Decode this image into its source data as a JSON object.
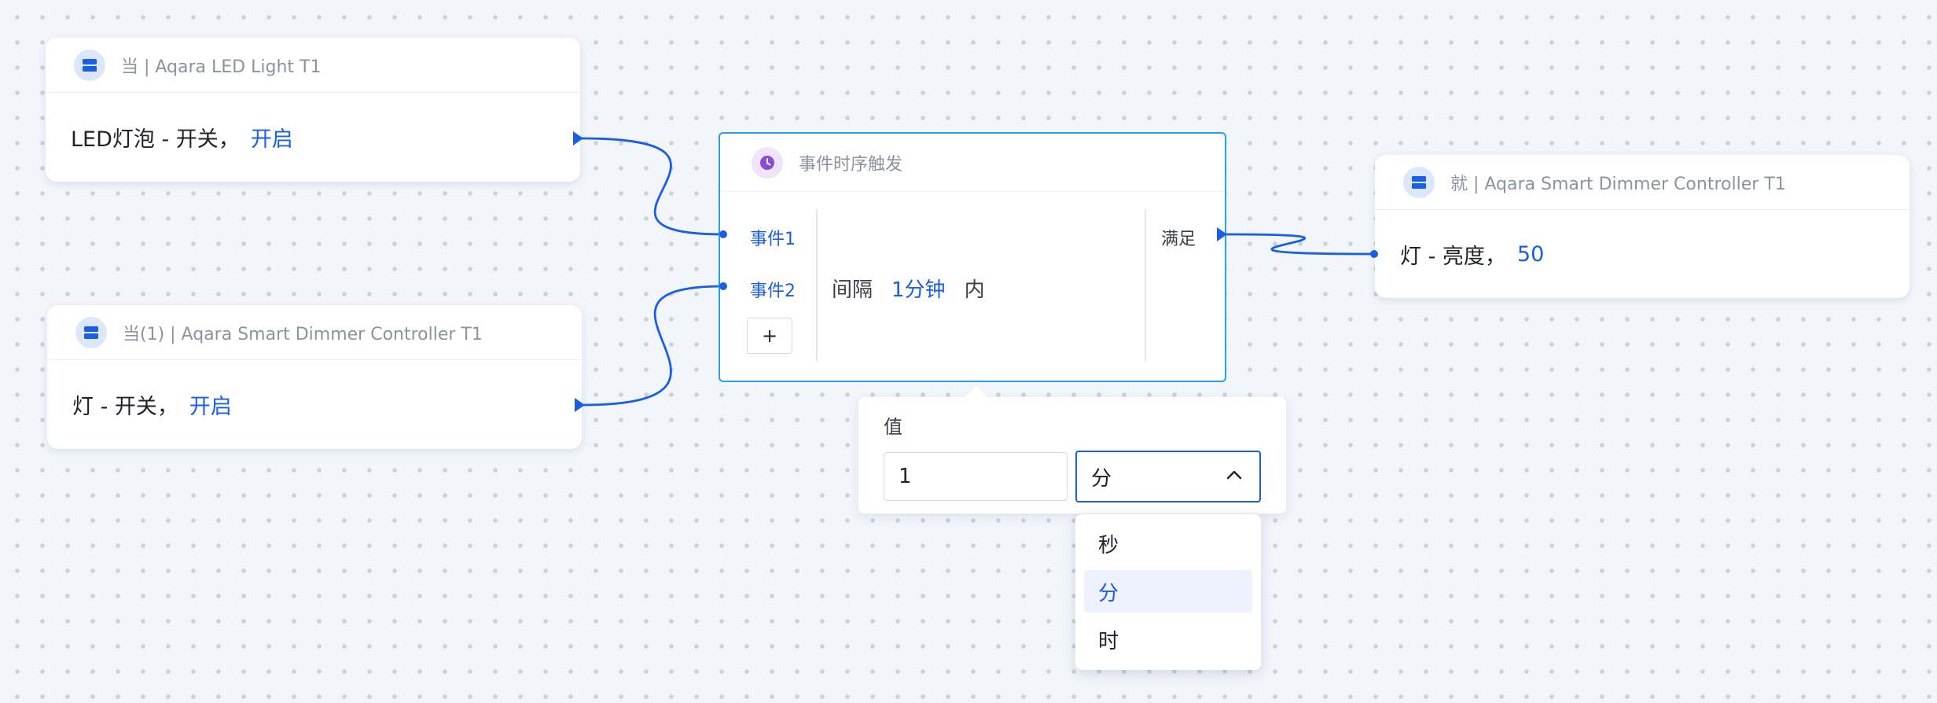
{
  "nodes": {
    "trigger1": {
      "title": "当 | Aqara LED Light T1",
      "property": "LED灯泡 - 开关，",
      "value": "开启",
      "icon": "device-icon"
    },
    "trigger2": {
      "title": "当(1) | Aqara Smart Dimmer Controller T1",
      "property": "灯 - 开关，",
      "value": "开启",
      "icon": "device-icon"
    },
    "sequence": {
      "title": "事件时序触发",
      "icon": "clock-icon",
      "event1": "事件1",
      "event2": "事件2",
      "add_label": "+",
      "interval_prefix": "间隔",
      "interval_value": "1分钟",
      "interval_suffix": "内",
      "output_label": "满足"
    },
    "action": {
      "title": "就 | Aqara Smart Dimmer Controller T1",
      "property": "灯 - 亮度，",
      "value": "50",
      "icon": "device-icon"
    }
  },
  "value_popover": {
    "label": "值",
    "number": "1",
    "unit": "分",
    "unit_options": [
      "秒",
      "分",
      "时"
    ],
    "selected_option": "分"
  },
  "colors": {
    "accent": "#1a5ee6",
    "selection_border": "#2aa0e6",
    "clock_icon": "#8b4ad8",
    "device_icon_bg": "#dde7fb"
  }
}
